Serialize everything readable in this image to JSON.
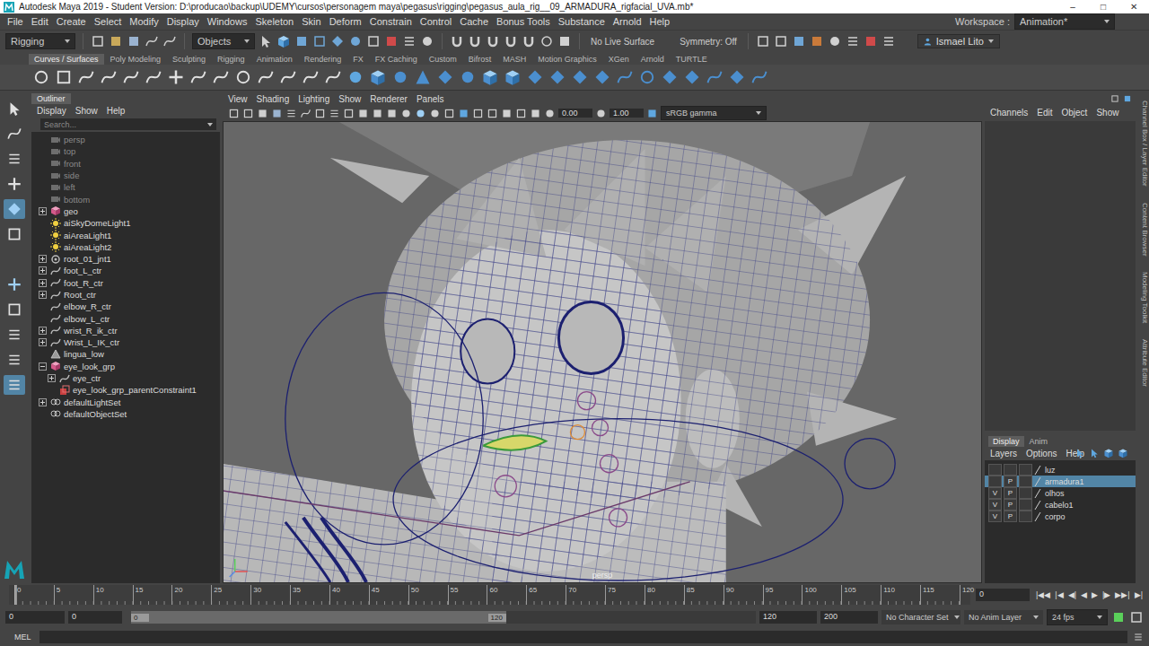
{
  "window": {
    "title": "Autodesk Maya 2019 - Student Version: D:\\producao\\backup\\UDEMY\\cursos\\personagem maya\\pegasus\\rigging\\pegasus_aula_rig__09_ARMADURA_rigfacial_UVA.mb*",
    "controls": [
      "–",
      "□",
      "✕"
    ]
  },
  "menu": [
    "File",
    "Edit",
    "Create",
    "Select",
    "Modify",
    "Display",
    "Windows",
    "Skeleton",
    "Skin",
    "Deform",
    "Constrain",
    "Control",
    "Cache",
    "Bonus Tools",
    "Substance",
    "Arnold",
    "Help"
  ],
  "workspace": {
    "label": "Workspace :",
    "value": "Animation*"
  },
  "status_line": {
    "mode": "Rigging",
    "select_mode": "Objects",
    "live_surface": "No Live Surface",
    "symmetry": "Symmetry: Off",
    "user": "Ismael Lito"
  },
  "shelf": {
    "tabs": [
      {
        "label": "Curves / Surfaces",
        "selected": true
      },
      {
        "label": "Poly Modeling",
        "selected": false
      },
      {
        "label": "Sculpting",
        "selected": false
      },
      {
        "label": "Rigging",
        "selected": false
      },
      {
        "label": "Animation",
        "selected": false
      },
      {
        "label": "Rendering",
        "selected": false
      },
      {
        "label": "FX",
        "selected": false
      },
      {
        "label": "FX Caching",
        "selected": false
      },
      {
        "label": "Custom",
        "selected": false
      },
      {
        "label": "Bifrost",
        "selected": false
      },
      {
        "label": "MASH",
        "selected": false
      },
      {
        "label": "Motion Graphics",
        "selected": false
      },
      {
        "label": "XGen",
        "selected": false
      },
      {
        "label": "Arnold",
        "selected": false
      },
      {
        "label": "TURTLE",
        "selected": false
      }
    ]
  },
  "toolbox": {
    "tools": [
      {
        "selected": false
      },
      {
        "selected": false
      },
      {
        "selected": false
      },
      {
        "selected": false
      },
      {
        "selected": true
      },
      {
        "selected": false
      }
    ],
    "layouts": [
      {
        "selected": false
      },
      {
        "selected": false
      },
      {
        "selected": false
      },
      {
        "selected": false
      },
      {
        "selected": true
      }
    ]
  },
  "outliner": {
    "title": "Outliner",
    "menu": [
      "Display",
      "Show",
      "Help"
    ],
    "search_placeholder": "Search...",
    "items": [
      {
        "label": "persp",
        "kind": "camera",
        "depth": 0,
        "expandable": false,
        "expanded": false,
        "dimmed": true,
        "selected": false
      },
      {
        "label": "top",
        "kind": "camera",
        "depth": 0,
        "expandable": false,
        "expanded": false,
        "dimmed": true,
        "selected": false
      },
      {
        "label": "front",
        "kind": "camera",
        "depth": 0,
        "expandable": false,
        "expanded": false,
        "dimmed": true,
        "selected": false
      },
      {
        "label": "side",
        "kind": "camera",
        "depth": 0,
        "expandable": false,
        "expanded": false,
        "dimmed": true,
        "selected": false
      },
      {
        "label": "left",
        "kind": "camera",
        "depth": 0,
        "expandable": false,
        "expanded": false,
        "dimmed": true,
        "selected": false
      },
      {
        "label": "bottom",
        "kind": "camera",
        "depth": 0,
        "expandable": false,
        "expanded": false,
        "dimmed": true,
        "selected": false
      },
      {
        "label": "geo",
        "kind": "group",
        "depth": 0,
        "expandable": true,
        "expanded": false,
        "dimmed": false,
        "selected": false
      },
      {
        "label": "aiSkyDomeLight1",
        "kind": "light",
        "depth": 0,
        "expandable": false,
        "expanded": false,
        "dimmed": false,
        "selected": false
      },
      {
        "label": "aiAreaLight1",
        "kind": "light",
        "depth": 0,
        "expandable": false,
        "expanded": false,
        "dimmed": false,
        "selected": false
      },
      {
        "label": "aiAreaLight2",
        "kind": "light",
        "depth": 0,
        "expandable": false,
        "expanded": false,
        "dimmed": false,
        "selected": false
      },
      {
        "label": "root_01_jnt1",
        "kind": "joint",
        "depth": 0,
        "expandable": true,
        "expanded": false,
        "dimmed": false,
        "selected": false
      },
      {
        "label": "foot_L_ctr",
        "kind": "curve",
        "depth": 0,
        "expandable": true,
        "expanded": false,
        "dimmed": false,
        "selected": false
      },
      {
        "label": "foot_R_ctr",
        "kind": "curve",
        "depth": 0,
        "expandable": true,
        "expanded": false,
        "dimmed": false,
        "selected": false
      },
      {
        "label": "Root_ctr",
        "kind": "curve",
        "depth": 0,
        "expandable": true,
        "expanded": false,
        "dimmed": false,
        "selected": false
      },
      {
        "label": "elbow_R_ctr",
        "kind": "curve",
        "depth": 0,
        "expandable": false,
        "expanded": false,
        "dimmed": false,
        "selected": false
      },
      {
        "label": "elbow_L_ctr",
        "kind": "curve",
        "depth": 0,
        "expandable": false,
        "expanded": false,
        "dimmed": false,
        "selected": false
      },
      {
        "label": "wrist_R_ik_ctr",
        "kind": "curve",
        "depth": 0,
        "expandable": true,
        "expanded": false,
        "dimmed": false,
        "selected": false
      },
      {
        "label": "Wrist_L_IK_ctr",
        "kind": "curve",
        "depth": 0,
        "expandable": true,
        "expanded": false,
        "dimmed": false,
        "selected": false
      },
      {
        "label": "lingua_low",
        "kind": "mesh",
        "depth": 0,
        "expandable": false,
        "expanded": false,
        "dimmed": false,
        "selected": false
      },
      {
        "label": "eye_look_grp",
        "kind": "group",
        "depth": 0,
        "expandable": true,
        "expanded": true,
        "dimmed": false,
        "selected": false
      },
      {
        "label": "eye_ctr",
        "kind": "curve",
        "depth": 1,
        "expandable": true,
        "expanded": false,
        "dimmed": false,
        "selected": false
      },
      {
        "label": "eye_look_grp_parentConstraint1",
        "kind": "constraint",
        "depth": 1,
        "expandable": false,
        "expanded": false,
        "dimmed": false,
        "selected": false
      },
      {
        "label": "defaultLightSet",
        "kind": "set",
        "depth": 0,
        "expandable": true,
        "expanded": false,
        "dimmed": false,
        "selected": false
      },
      {
        "label": "defaultObjectSet",
        "kind": "set",
        "depth": 0,
        "expandable": false,
        "expanded": false,
        "dimmed": false,
        "selected": false
      }
    ]
  },
  "viewport": {
    "menu": [
      "View",
      "Shading",
      "Lighting",
      "Show",
      "Renderer",
      "Panels"
    ],
    "exposure": "0.00",
    "gamma": "1.00",
    "color_space": "sRGB gamma",
    "camera": "persp"
  },
  "channel_box": {
    "menu": [
      "Channels",
      "Edit",
      "Object",
      "Show"
    ]
  },
  "side_tabs": [
    "Channel Box / Layer Editor",
    "Content Browser",
    "Modeling Toolkit",
    "Attribute Editor"
  ],
  "layer_editor": {
    "tabs": [
      {
        "label": "Display",
        "selected": true
      },
      {
        "label": "Anim",
        "selected": false
      }
    ],
    "menu": [
      "Layers",
      "Options",
      "Help"
    ],
    "visible_label": "V",
    "playback_label": "P",
    "layers": [
      {
        "name": "luz",
        "visible": false,
        "playback": false,
        "selected": false
      },
      {
        "name": "armadura1",
        "visible": false,
        "playback": true,
        "selected": true
      },
      {
        "name": "olhos",
        "visible": true,
        "playback": true,
        "selected": false
      },
      {
        "name": "cabelo1",
        "visible": true,
        "playback": true,
        "selected": false
      },
      {
        "name": "corpo",
        "visible": true,
        "playback": true,
        "selected": false
      }
    ]
  },
  "timeline": {
    "ticks": [
      "0",
      "5",
      "10",
      "15",
      "20",
      "25",
      "30",
      "35",
      "40",
      "45",
      "50",
      "55",
      "60",
      "65",
      "70",
      "75",
      "80",
      "85",
      "90",
      "95",
      "100",
      "105",
      "110",
      "115",
      "120"
    ],
    "current_frame": "0",
    "playback_controls": [
      "|◀◀",
      "|◀",
      "◀|",
      "◀",
      "▶",
      "|▶",
      "▶▶|",
      "▶|"
    ]
  },
  "range": {
    "start": "0",
    "playback_start": "0",
    "slider_start": "0",
    "slider_end": "120",
    "playback_end": "120",
    "end": "200",
    "character_set": "No Character Set",
    "anim_layer": "No Anim Layer",
    "fps": "24 fps"
  },
  "command_line": {
    "label": "MEL"
  }
}
